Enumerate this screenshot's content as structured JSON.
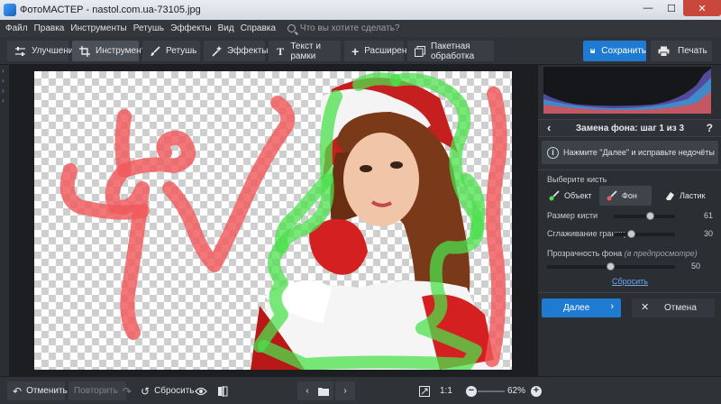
{
  "window": {
    "title": "ФотоМАСТЕР - nastol.com.ua-73105.jpg",
    "controls": {
      "minimize": "—",
      "maximize": "☐",
      "close": "✕"
    }
  },
  "menu": {
    "items": [
      "Файл",
      "Правка",
      "Инструменты",
      "Ретушь",
      "Эффекты",
      "Вид",
      "Справка"
    ],
    "search_placeholder": "Что вы хотите сделать?"
  },
  "toolbar": {
    "tabs": [
      {
        "label": "Улучшения",
        "icon": "sliders-icon",
        "active": false
      },
      {
        "label": "Инструменты",
        "icon": "crop-icon",
        "active": true
      },
      {
        "label": "Ретушь",
        "icon": "brush-icon",
        "active": false
      },
      {
        "label": "Эффекты",
        "icon": "magic-wand-icon",
        "active": false
      },
      {
        "label": "Текст и рамки",
        "icon": "text-icon",
        "active": false
      },
      {
        "label": "Расширения",
        "icon": "plus-icon",
        "active": false
      },
      {
        "label": "Пакетная обработка",
        "icon": "batch-icon",
        "active": false
      }
    ],
    "save_label": "Сохранить",
    "print_label": "Печать"
  },
  "panel": {
    "step_title": "Замена фона: шаг 1 из 3",
    "help": "?",
    "hint": "Нажмите \"Далее\" и исправьте недочёты",
    "brush_label": "Выберите кисть",
    "brushes": [
      {
        "label": "Объект",
        "active": false
      },
      {
        "label": "Фон",
        "active": true
      },
      {
        "label": "Ластик",
        "active": false
      }
    ],
    "sliders": {
      "brush_size": {
        "label": "Размер кисти",
        "value": "61",
        "level": 0.61
      },
      "edge_smoothing": {
        "label": "Сглаживание границ",
        "value": "30",
        "level": 0.3
      },
      "bg_opacity": {
        "label": "Прозрачность фона",
        "label_note": "(в предпросмотре)",
        "value": "50",
        "level": 0.5
      }
    },
    "reset_link": "Сбросить",
    "next_label": "Далее",
    "cancel_label": "Отмена"
  },
  "bottom": {
    "undo_label": "Отменить",
    "redo_label": "Повторить",
    "reset_label": "Сбросить",
    "ratio_label": "1:1",
    "zoom_value": "62%"
  },
  "colors": {
    "accent": "#1f7bd1",
    "object_stroke": "#4be04b",
    "background_stroke": "#f0585a"
  }
}
